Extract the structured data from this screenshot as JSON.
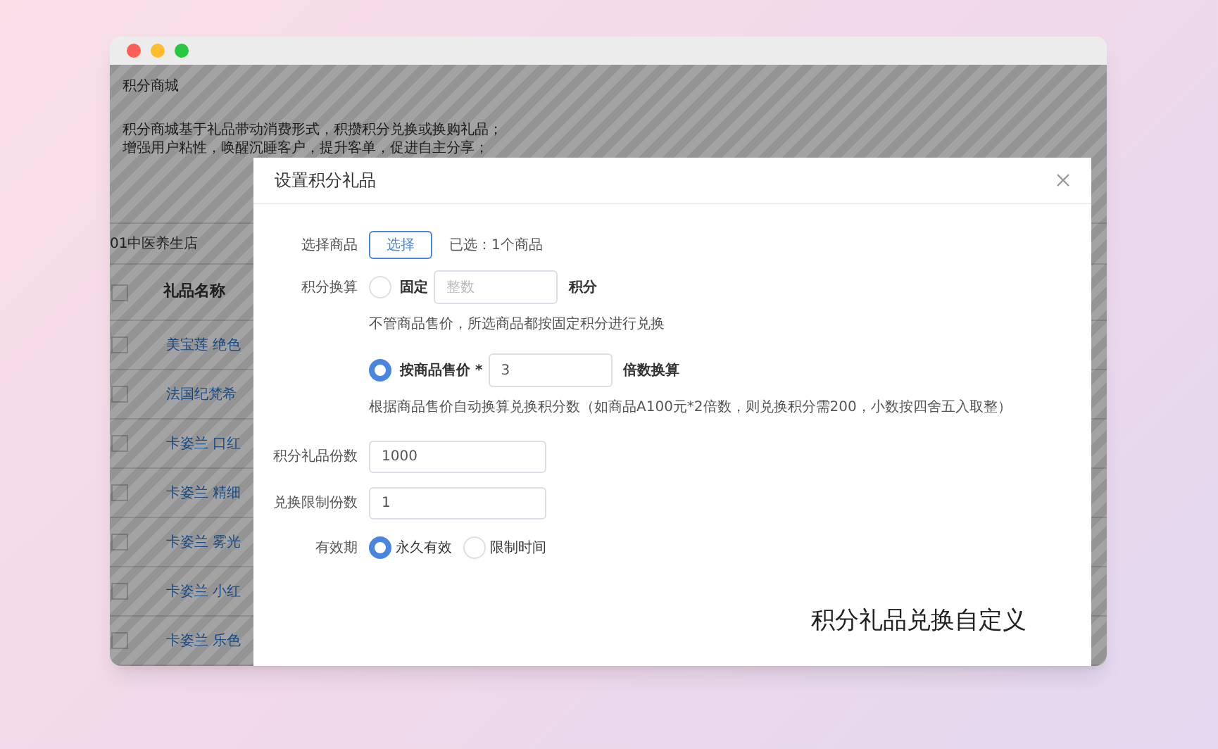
{
  "background_page": {
    "title": "积分商城",
    "intro": [
      "积分商城基于礼品带动消费形式，积攒积分兑换或换购礼品；",
      "增强用户粘性，唤醒沉睡客户，提升客单，促进自主分享；"
    ],
    "store": "01中医养生店",
    "table": {
      "select_all_checked": false,
      "columns": [
        "礼品名称"
      ],
      "rows": [
        {
          "name": "美宝莲 绝色",
          "checked": false
        },
        {
          "name": "法国纪梵希",
          "checked": false
        },
        {
          "name": "卡姿兰 口红",
          "checked": false
        },
        {
          "name": "卡姿兰 精细",
          "checked": false
        },
        {
          "name": "卡姿兰 雾光",
          "checked": false
        },
        {
          "name": "卡姿兰 小红",
          "checked": false
        },
        {
          "name": "卡姿兰 乐色",
          "checked": false
        }
      ]
    }
  },
  "dialog": {
    "title": "设置积分礼品",
    "select_goods": {
      "label": "选择商品",
      "button": "选择",
      "selected_text": "已选：1个商品"
    },
    "conversion": {
      "label": "积分换算",
      "options": [
        {
          "label": "固定",
          "selected": false,
          "placeholder": "整数",
          "unit": "积分",
          "hint": "不管商品售价，所选商品都按固定积分进行兑换"
        },
        {
          "label": "按商品售价 *",
          "selected": true,
          "value": "3",
          "unit": "倍数换算",
          "hint": "根据商品售价自动换算兑换积分数（如商品A100元*2倍数，则兑换积分需200，小数按四舍五入取整）"
        }
      ]
    },
    "fields": [
      {
        "label": "积分礼品份数",
        "value": "1000"
      },
      {
        "label": "兑换限制份数",
        "value": "1"
      }
    ],
    "validity": {
      "label": "有效期",
      "options": [
        {
          "label": "永久有效",
          "selected": true
        },
        {
          "label": "限制时间",
          "selected": false
        }
      ]
    }
  },
  "caption": "积分礼品兑换自定义"
}
